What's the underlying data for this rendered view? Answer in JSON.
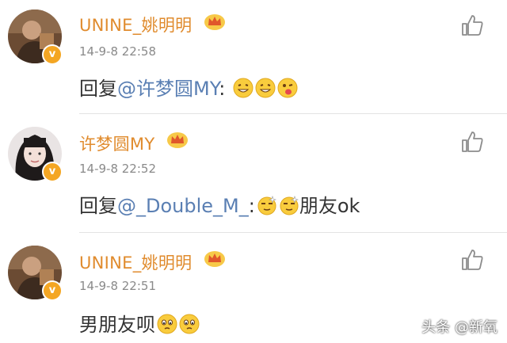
{
  "comments": [
    {
      "name": "UNINE_姚明明",
      "time": "14-9-8 22:58",
      "prefix": "回复",
      "mention": "@许梦圆MY",
      "suffix": ":",
      "emojis": [
        "grin-icon",
        "grin-icon",
        "tongue-icon"
      ],
      "badge": "v"
    },
    {
      "name": "许梦圆MY",
      "time": "14-9-8 22:52",
      "prefix": "回复",
      "mention": "@_Double_M_",
      "suffix": ":",
      "emojis": [
        "sparkle-face-icon",
        "sparkle-face-icon"
      ],
      "tail": "朋友ok",
      "badge": "v"
    },
    {
      "name": "UNINE_姚明明",
      "time": "14-9-8 22:51",
      "prefix": "男朋友呗",
      "mention": "",
      "suffix": "",
      "emojis": [
        "worried-icon",
        "worried-icon"
      ],
      "badge": "v"
    }
  ],
  "watermark": "头条 @新氧",
  "colors": {
    "name": "#e08b2d",
    "mention": "#5a7fb3",
    "badge": "#f4a623"
  }
}
